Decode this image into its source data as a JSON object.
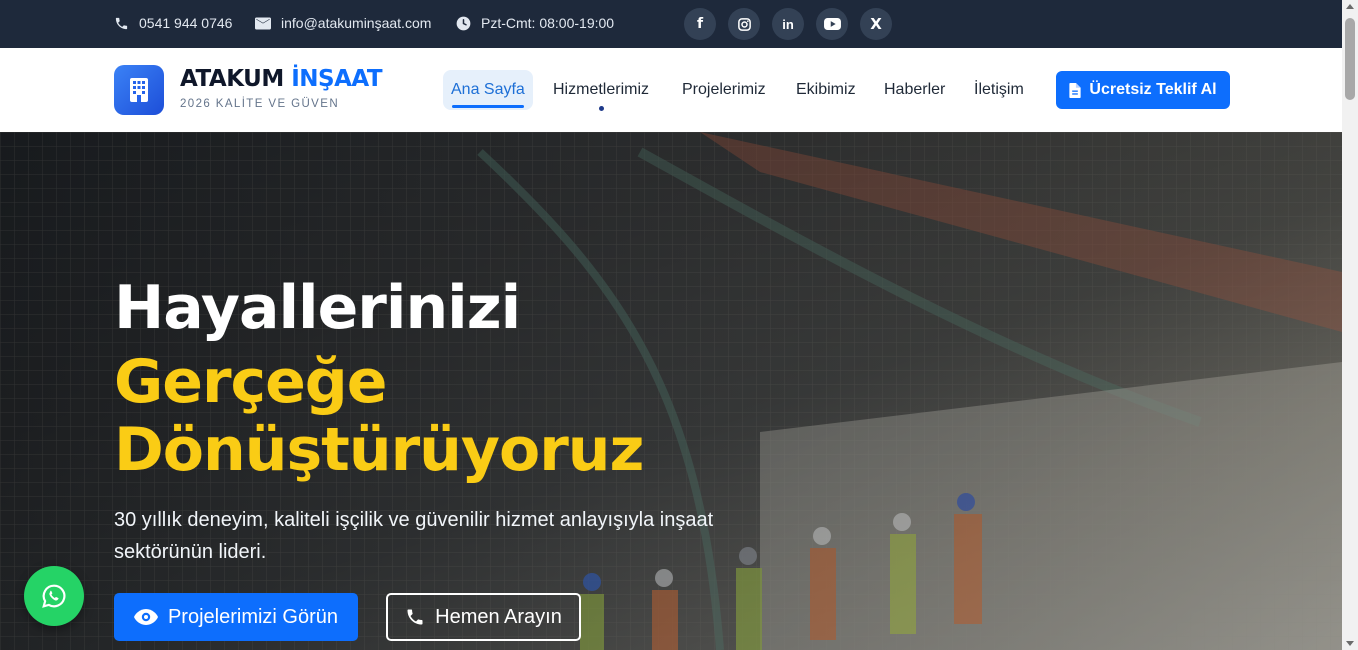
{
  "topbar": {
    "phone": "0541 944 0746",
    "email": "info@atakuminşaat.com",
    "hours": "Pzt-Cmt: 08:00-19:00",
    "social": [
      {
        "name": "facebook-icon",
        "glyph": "f"
      },
      {
        "name": "instagram-icon",
        "glyph": ""
      },
      {
        "name": "linkedin-icon",
        "glyph": "in"
      },
      {
        "name": "youtube-icon",
        "glyph": ""
      },
      {
        "name": "x-icon",
        "glyph": "X"
      }
    ]
  },
  "header": {
    "brand_main": "ATAKUM ",
    "brand_accent": "İNŞAAT",
    "tagline": "2026 KALİTE VE GÜVEN",
    "nav": [
      {
        "label": "Ana Sayfa",
        "active": true
      },
      {
        "label": "Hizmetlerimiz",
        "active": false,
        "has_dropdown": true
      },
      {
        "label": "Projelerimiz",
        "active": false
      },
      {
        "label": "Ekibimiz",
        "active": false
      },
      {
        "label": "Haberler",
        "active": false
      },
      {
        "label": "İletişim",
        "active": false
      }
    ],
    "cta_label": "Ücretsiz Teklif Al"
  },
  "hero": {
    "title_line1": "Hayallerinizi",
    "title_line2": "Gerçeğe",
    "title_line3": "Dönüştürüyoruz",
    "lead": "30 yıllık deneyim, kaliteli işçilik ve güvenilir hizmet anlayışıyla inşaat sektörünün lideri.",
    "primary_button": "Projelerimizi Görün",
    "secondary_button": "Hemen Arayın"
  },
  "colors": {
    "accent": "#0d6efd",
    "highlight": "#facc15",
    "topbar": "#1e293b",
    "whatsapp": "#25d366"
  }
}
